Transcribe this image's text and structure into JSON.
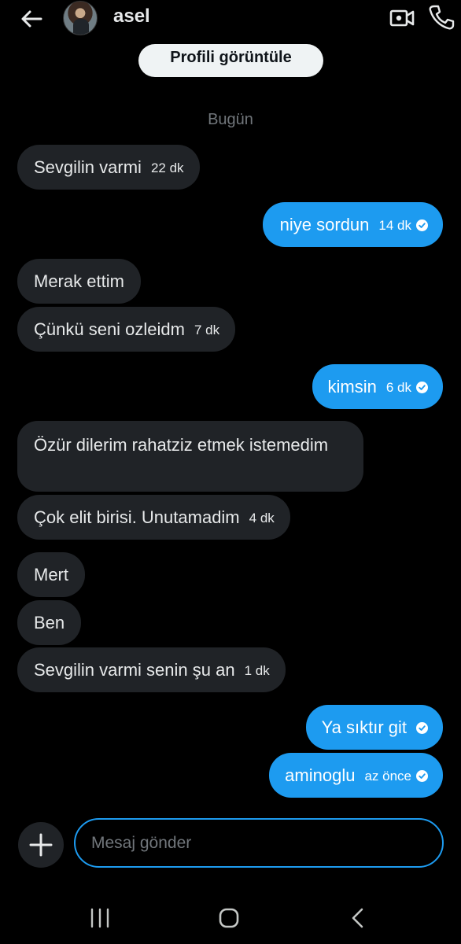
{
  "header": {
    "title": "asel"
  },
  "profile_button": {
    "label": "Profili görüntüle"
  },
  "date_separator": "Bugün",
  "messages": [
    {
      "dir": "in",
      "text": "Sevgilin varmi",
      "time": "22 dk"
    },
    {
      "dir": "out",
      "text": "niye sordun",
      "time": "14 dk",
      "status": "sent"
    },
    {
      "dir": "in",
      "text": "Merak ettim",
      "time": ""
    },
    {
      "dir": "in",
      "text": "Çünkü seni ozleidm",
      "time": "7 dk"
    },
    {
      "dir": "out",
      "text": "kimsin",
      "time": "6 dk",
      "status": "sent"
    },
    {
      "dir": "in",
      "text": "Özür dilerim rahatziz etmek istemedim",
      "time": ""
    },
    {
      "dir": "in",
      "text": "Çok elit birisi. Unutamadim",
      "time": "4 dk"
    },
    {
      "dir": "in",
      "text": "Mert",
      "time": ""
    },
    {
      "dir": "in",
      "text": "Ben",
      "time": ""
    },
    {
      "dir": "in",
      "text": "Sevgilin varmi senin şu an",
      "time": "1 dk"
    },
    {
      "dir": "out",
      "text": "Ya sıktır git",
      "time": "",
      "status": "sent"
    },
    {
      "dir": "out",
      "text": "aminoglu",
      "time": "az önce",
      "status": "sent"
    }
  ],
  "composer": {
    "placeholder": "Mesaj gönder",
    "value": ""
  },
  "icons": {
    "back": "arrow-left-icon",
    "video": "video-call-icon",
    "phone": "phone-icon",
    "add": "plus-icon",
    "check": "check-circle-icon",
    "nav_recent": "recent-apps-icon",
    "nav_home": "home-icon",
    "nav_back": "nav-back-icon"
  },
  "colors": {
    "accent": "#1d9bf0",
    "incoming_bubble": "#202327",
    "background": "#000000",
    "muted_text": "#71767b"
  }
}
